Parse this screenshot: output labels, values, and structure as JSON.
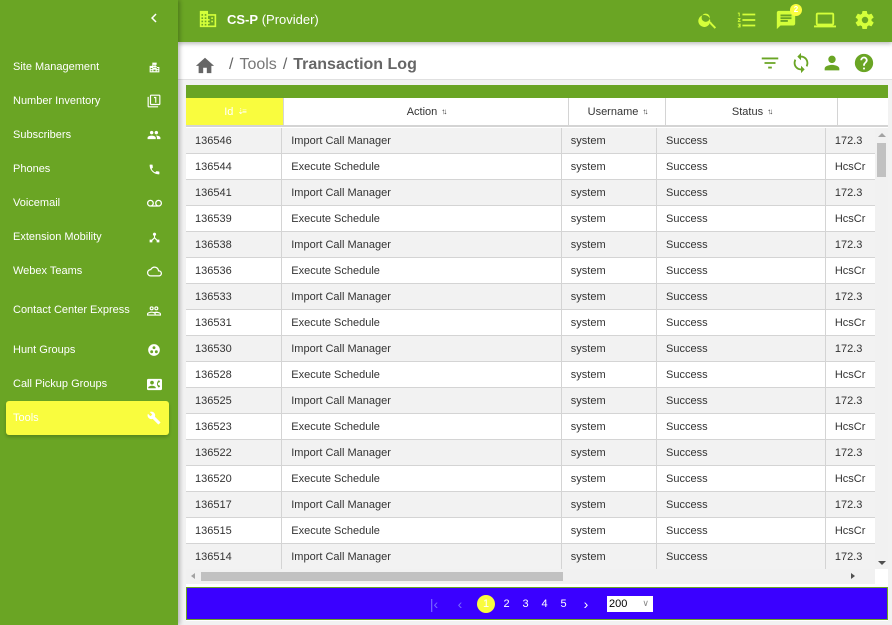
{
  "header": {
    "org_name": "CS-P",
    "org_type": "(Provider)",
    "notification_count": "2",
    "icons": [
      "search-icon",
      "numbered-list-icon",
      "chat-icon",
      "laptop-icon",
      "gear-icon"
    ]
  },
  "sidebar": {
    "items": [
      {
        "label": "Site Management",
        "icon": "building-icon"
      },
      {
        "label": "Number Inventory",
        "icon": "number-box-icon"
      },
      {
        "label": "Subscribers",
        "icon": "people-icon"
      },
      {
        "label": "Phones",
        "icon": "phone-icon"
      },
      {
        "label": "Voicemail",
        "icon": "voicemail-icon"
      },
      {
        "label": "Extension Mobility",
        "icon": "hub-icon"
      },
      {
        "label": "Webex Teams",
        "icon": "cloud-icon"
      },
      {
        "label": "Contact Center Express",
        "icon": "group-outline-icon"
      },
      {
        "label": "Hunt Groups",
        "icon": "hunt-group-icon"
      },
      {
        "label": "Call Pickup Groups",
        "icon": "contact-card-icon"
      },
      {
        "label": "Tools",
        "icon": "wrench-icon",
        "active": true
      }
    ]
  },
  "breadcrumb": {
    "parent": "Tools",
    "current": "Transaction Log",
    "separator": "/"
  },
  "table": {
    "columns": [
      {
        "label": "Id",
        "sorted": true
      },
      {
        "label": "Action"
      },
      {
        "label": "Username"
      },
      {
        "label": "Status"
      },
      {
        "label": ""
      }
    ],
    "rows": [
      [
        "136546",
        "Import Call Manager",
        "system",
        "Success",
        "172.3"
      ],
      [
        "136544",
        "Execute Schedule",
        "system",
        "Success",
        "HcsCr"
      ],
      [
        "136541",
        "Import Call Manager",
        "system",
        "Success",
        "172.3"
      ],
      [
        "136539",
        "Execute Schedule",
        "system",
        "Success",
        "HcsCr"
      ],
      [
        "136538",
        "Import Call Manager",
        "system",
        "Success",
        "172.3"
      ],
      [
        "136536",
        "Execute Schedule",
        "system",
        "Success",
        "HcsCr"
      ],
      [
        "136533",
        "Import Call Manager",
        "system",
        "Success",
        "172.3"
      ],
      [
        "136531",
        "Execute Schedule",
        "system",
        "Success",
        "HcsCr"
      ],
      [
        "136530",
        "Import Call Manager",
        "system",
        "Success",
        "172.3"
      ],
      [
        "136528",
        "Execute Schedule",
        "system",
        "Success",
        "HcsCr"
      ],
      [
        "136525",
        "Import Call Manager",
        "system",
        "Success",
        "172.3"
      ],
      [
        "136523",
        "Execute Schedule",
        "system",
        "Success",
        "HcsCr"
      ],
      [
        "136522",
        "Import Call Manager",
        "system",
        "Success",
        "172.3"
      ],
      [
        "136520",
        "Execute Schedule",
        "system",
        "Success",
        "HcsCr"
      ],
      [
        "136517",
        "Import Call Manager",
        "system",
        "Success",
        "172.3"
      ],
      [
        "136515",
        "Execute Schedule",
        "system",
        "Success",
        "HcsCr"
      ],
      [
        "136514",
        "Import Call Manager",
        "system",
        "Success",
        "172.3"
      ]
    ]
  },
  "pagination": {
    "current": "1",
    "pages": [
      "2",
      "3",
      "4",
      "5"
    ],
    "page_size": "200"
  },
  "colors": {
    "brand_green": "#6aa524",
    "accent_yellow": "#f9fc3e",
    "pager_blue": "#3a00ff",
    "icon_lime": "#d4ff3a"
  }
}
